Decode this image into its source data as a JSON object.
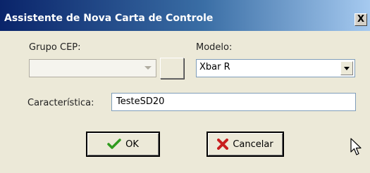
{
  "window": {
    "title": "Assistente de Nova Carta de Controle",
    "close_glyph": "X"
  },
  "form": {
    "grupo_cep_label": "Grupo CEP:",
    "grupo_cep_value": "",
    "modelo_label": "Modelo:",
    "modelo_value": "Xbar R",
    "caracteristica_label": "Característica:",
    "caracteristica_value": "TesteSD20"
  },
  "buttons": {
    "ok_label": "OK",
    "ok_icon": "checkmark-icon",
    "cancel_label": "Cancelar",
    "cancel_icon": "x-icon"
  },
  "colors": {
    "title_gradient_start": "#0a246a",
    "title_gradient_end": "#a6caf0",
    "check_green": "#2f9b1e",
    "cancel_red": "#c81e1e"
  }
}
